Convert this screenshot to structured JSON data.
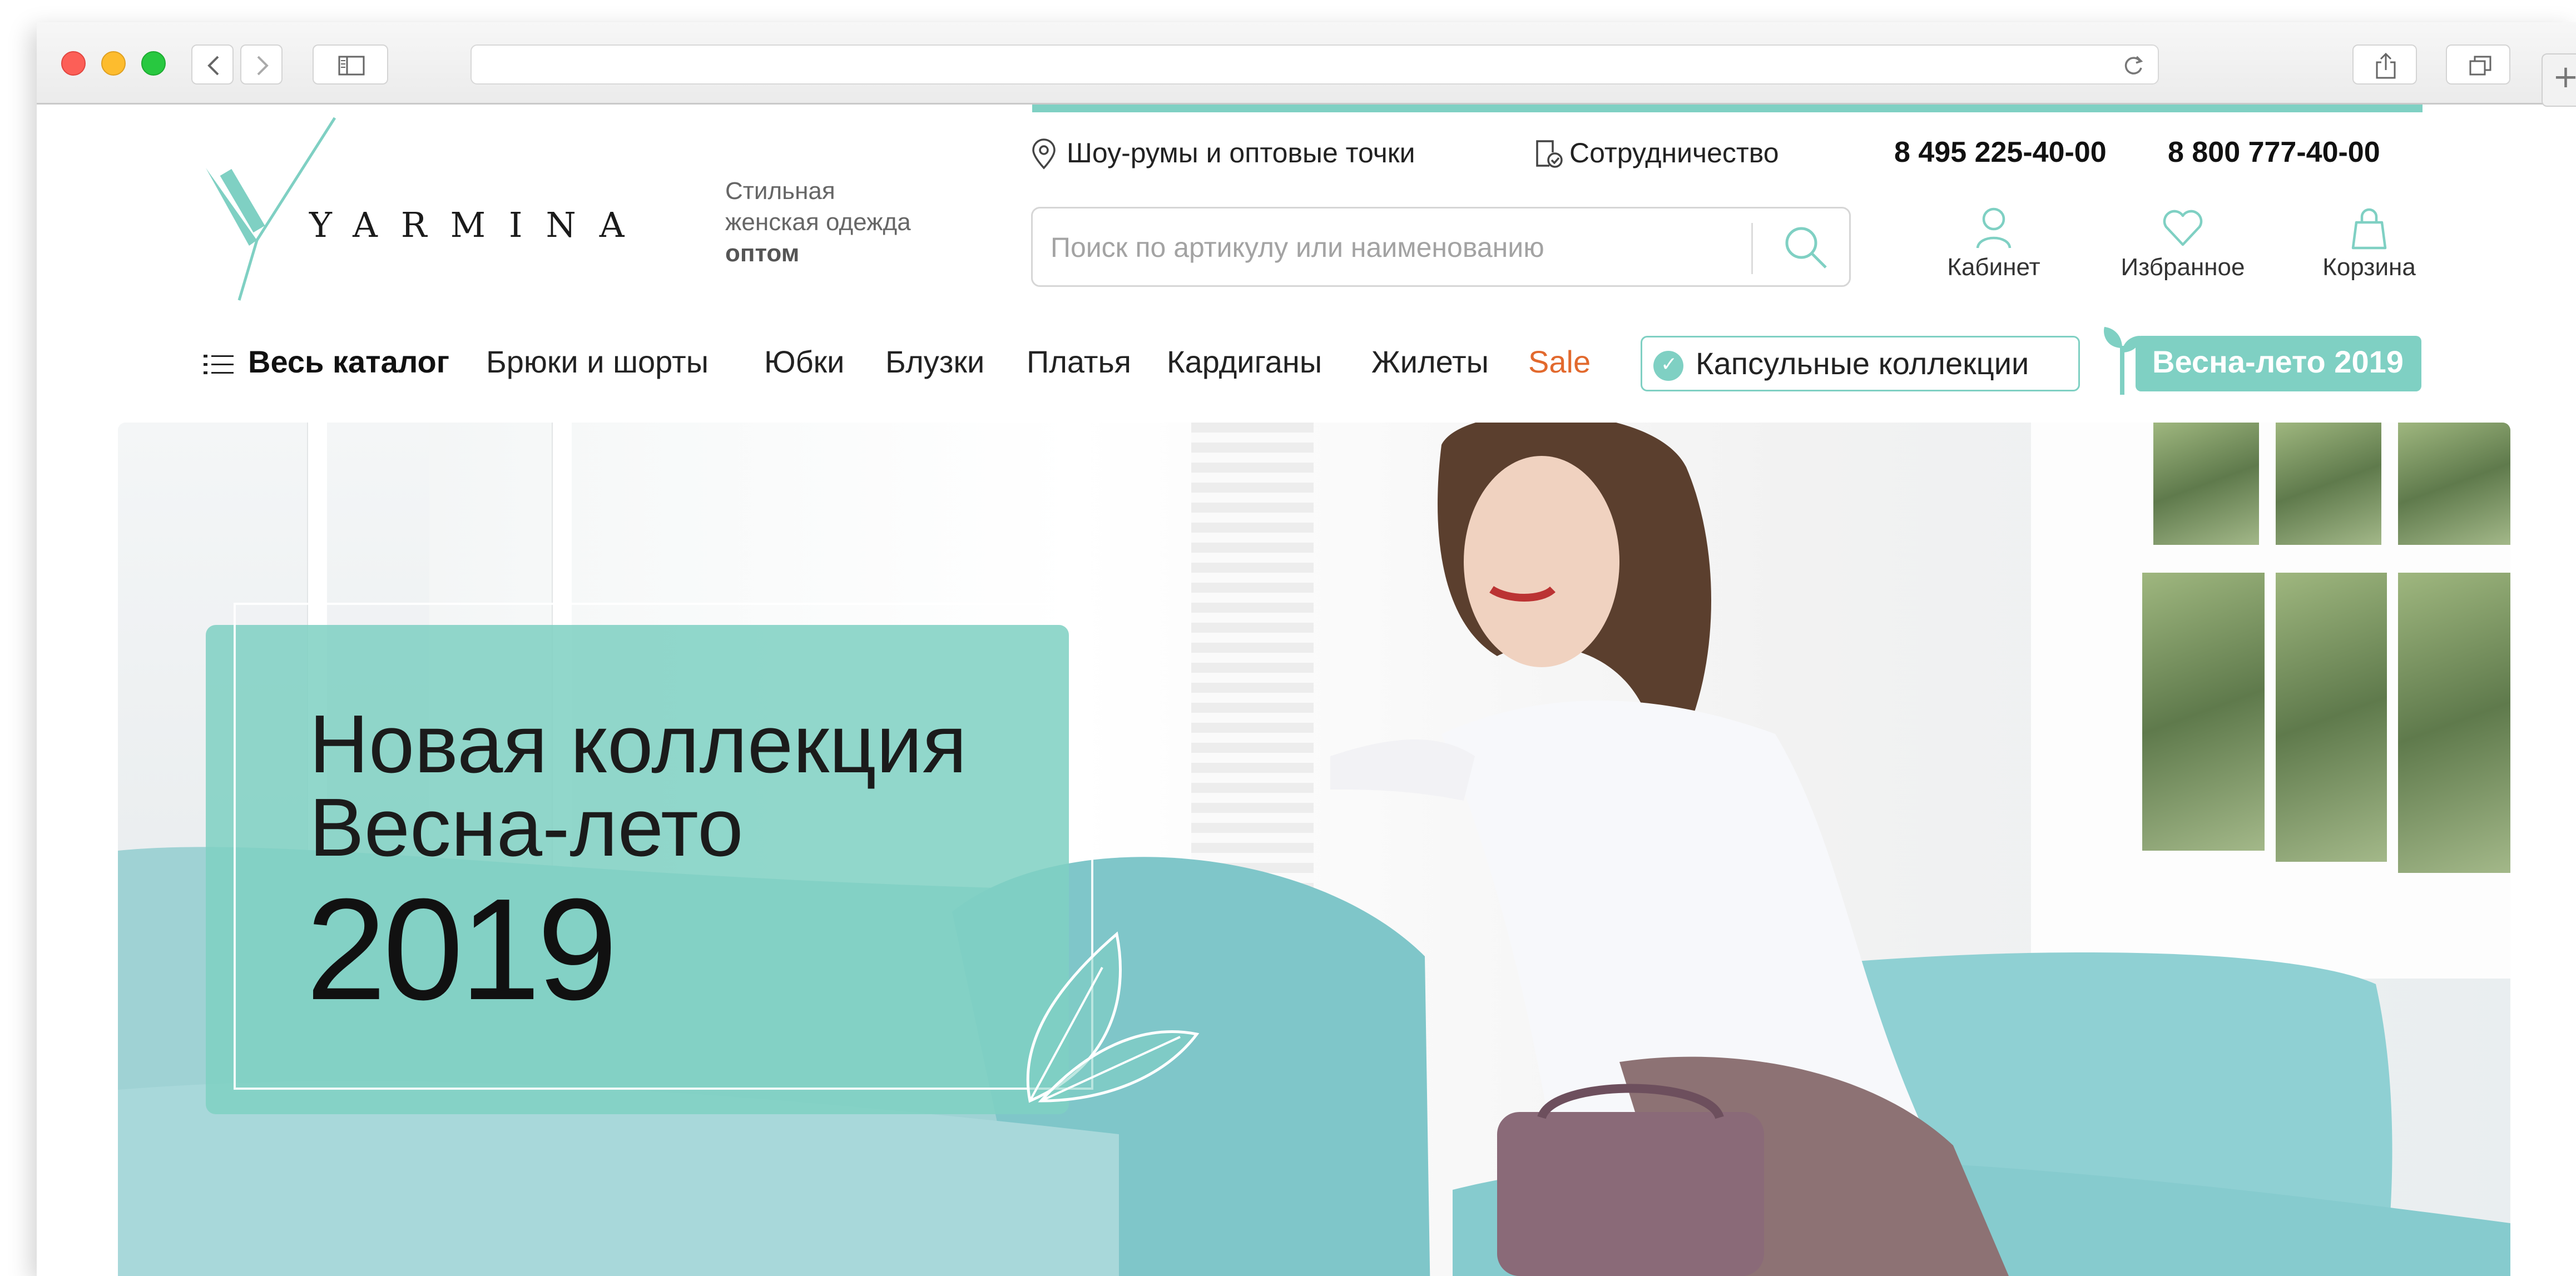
{
  "browser": {
    "url": ""
  },
  "header": {
    "logo_text": "YARMINA",
    "tagline_line1": "Стильная",
    "tagline_line2": "женская одежда",
    "tagline_line3": "оптом",
    "links": {
      "showrooms": "Шоу-румы и оптовые точки",
      "cooperation": "Сотрудничество"
    },
    "phones": [
      "8 495 225-40-00",
      "8 800 777-40-00"
    ],
    "search": {
      "placeholder": "Поиск по артикулу или наименованию"
    },
    "account_links": {
      "cabinet": "Кабинет",
      "favorites": "Избранное",
      "cart": "Корзина"
    }
  },
  "catalog_nav": {
    "all_catalog": "Весь каталог",
    "items": [
      "Брюки и шорты",
      "Юбки",
      "Блузки",
      "Платья",
      "Кардиганы",
      "Жилеты"
    ],
    "sale": "Sale",
    "capsule": "Капсульные коллекции",
    "spring": "Весна-лето 2019"
  },
  "hero": {
    "line1": "Новая коллекция",
    "line2": "Весна-лето",
    "year": "2019"
  },
  "colors": {
    "accent": "#7fd0c3",
    "sale": "#e2692d"
  },
  "icons": {
    "showrooms": "location-pin-icon",
    "cooperation": "document-check-icon",
    "search": "search-icon",
    "cabinet": "user-icon",
    "favorites": "heart-icon",
    "cart": "shopping-bag-icon",
    "catalog": "list-icon",
    "capsule": "check-badge-icon",
    "spring": "sprout-icon"
  }
}
